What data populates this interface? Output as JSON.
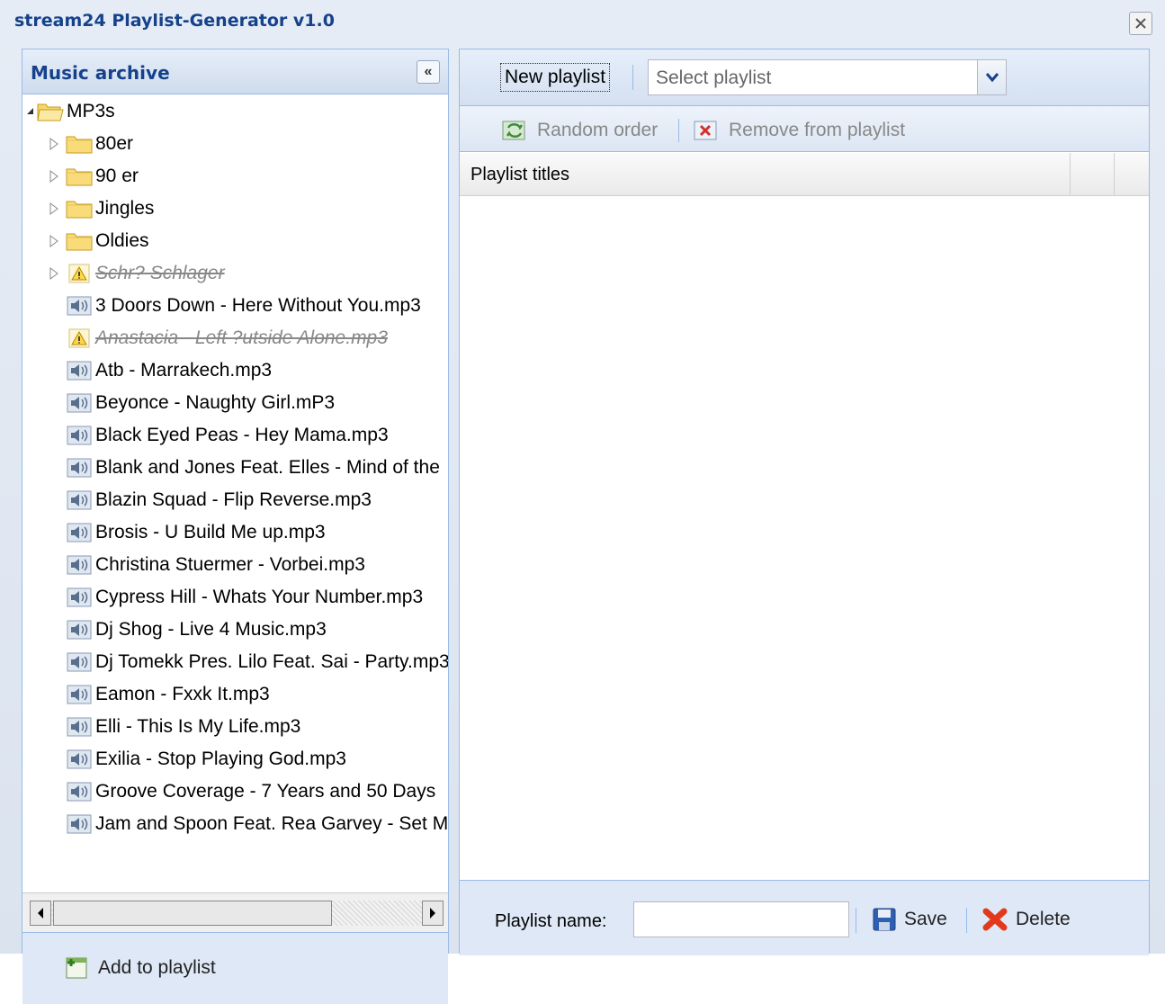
{
  "window": {
    "title": "stream24 Playlist-Generator v1.0"
  },
  "archive": {
    "title": "Music archive",
    "root": "MP3s",
    "items": [
      {
        "label": "80er",
        "kind": "folder",
        "disabled": false
      },
      {
        "label": "90 er",
        "kind": "folder",
        "disabled": false
      },
      {
        "label": "Jingles",
        "kind": "folder",
        "disabled": false
      },
      {
        "label": "Oldies",
        "kind": "folder",
        "disabled": false
      },
      {
        "label": "Schr? Schlager",
        "kind": "warn-folder",
        "disabled": true
      },
      {
        "label": "3 Doors Down - Here Without You.mp3",
        "kind": "file",
        "disabled": false
      },
      {
        "label": "Anastacia - Left ?utside Alone.mp3",
        "kind": "warn-file",
        "disabled": true
      },
      {
        "label": "Atb - Marrakech.mp3",
        "kind": "file",
        "disabled": false
      },
      {
        "label": "Beyonce - Naughty Girl.mP3",
        "kind": "file",
        "disabled": false
      },
      {
        "label": "Black Eyed Peas - Hey Mama.mp3",
        "kind": "file",
        "disabled": false
      },
      {
        "label": "Blank and Jones Feat. Elles - Mind of the",
        "kind": "file",
        "disabled": false
      },
      {
        "label": "Blazin Squad - Flip Reverse.mp3",
        "kind": "file",
        "disabled": false
      },
      {
        "label": "Brosis - U Build Me up.mp3",
        "kind": "file",
        "disabled": false
      },
      {
        "label": "Christina Stuermer - Vorbei.mp3",
        "kind": "file",
        "disabled": false
      },
      {
        "label": "Cypress Hill - Whats Your Number.mp3",
        "kind": "file",
        "disabled": false
      },
      {
        "label": "Dj Shog - Live 4 Music.mp3",
        "kind": "file",
        "disabled": false
      },
      {
        "label": "Dj Tomekk Pres. Lilo Feat. Sai - Party.mp3",
        "kind": "file",
        "disabled": false
      },
      {
        "label": "Eamon - Fxxk It.mp3",
        "kind": "file",
        "disabled": false
      },
      {
        "label": "Elli - This Is My Life.mp3",
        "kind": "file",
        "disabled": false
      },
      {
        "label": "Exilia - Stop Playing God.mp3",
        "kind": "file",
        "disabled": false
      },
      {
        "label": "Groove Coverage - 7 Years and 50 Days",
        "kind": "file",
        "disabled": false
      },
      {
        "label": "Jam and Spoon Feat. Rea Garvey - Set Me",
        "kind": "file",
        "disabled": false
      }
    ],
    "add_label": "Add to playlist"
  },
  "playlist": {
    "new_label": "New playlist",
    "select_placeholder": "Select playlist",
    "random_label": "Random order",
    "remove_label": "Remove from playlist",
    "column_title": "Playlist titles",
    "name_label": "Playlist name:",
    "name_value": "",
    "save_label": "Save",
    "delete_label": "Delete"
  },
  "colors": {
    "header_text": "#15428b",
    "panel_border": "#99bbe8",
    "panel_bg": "#dfe8f6"
  }
}
